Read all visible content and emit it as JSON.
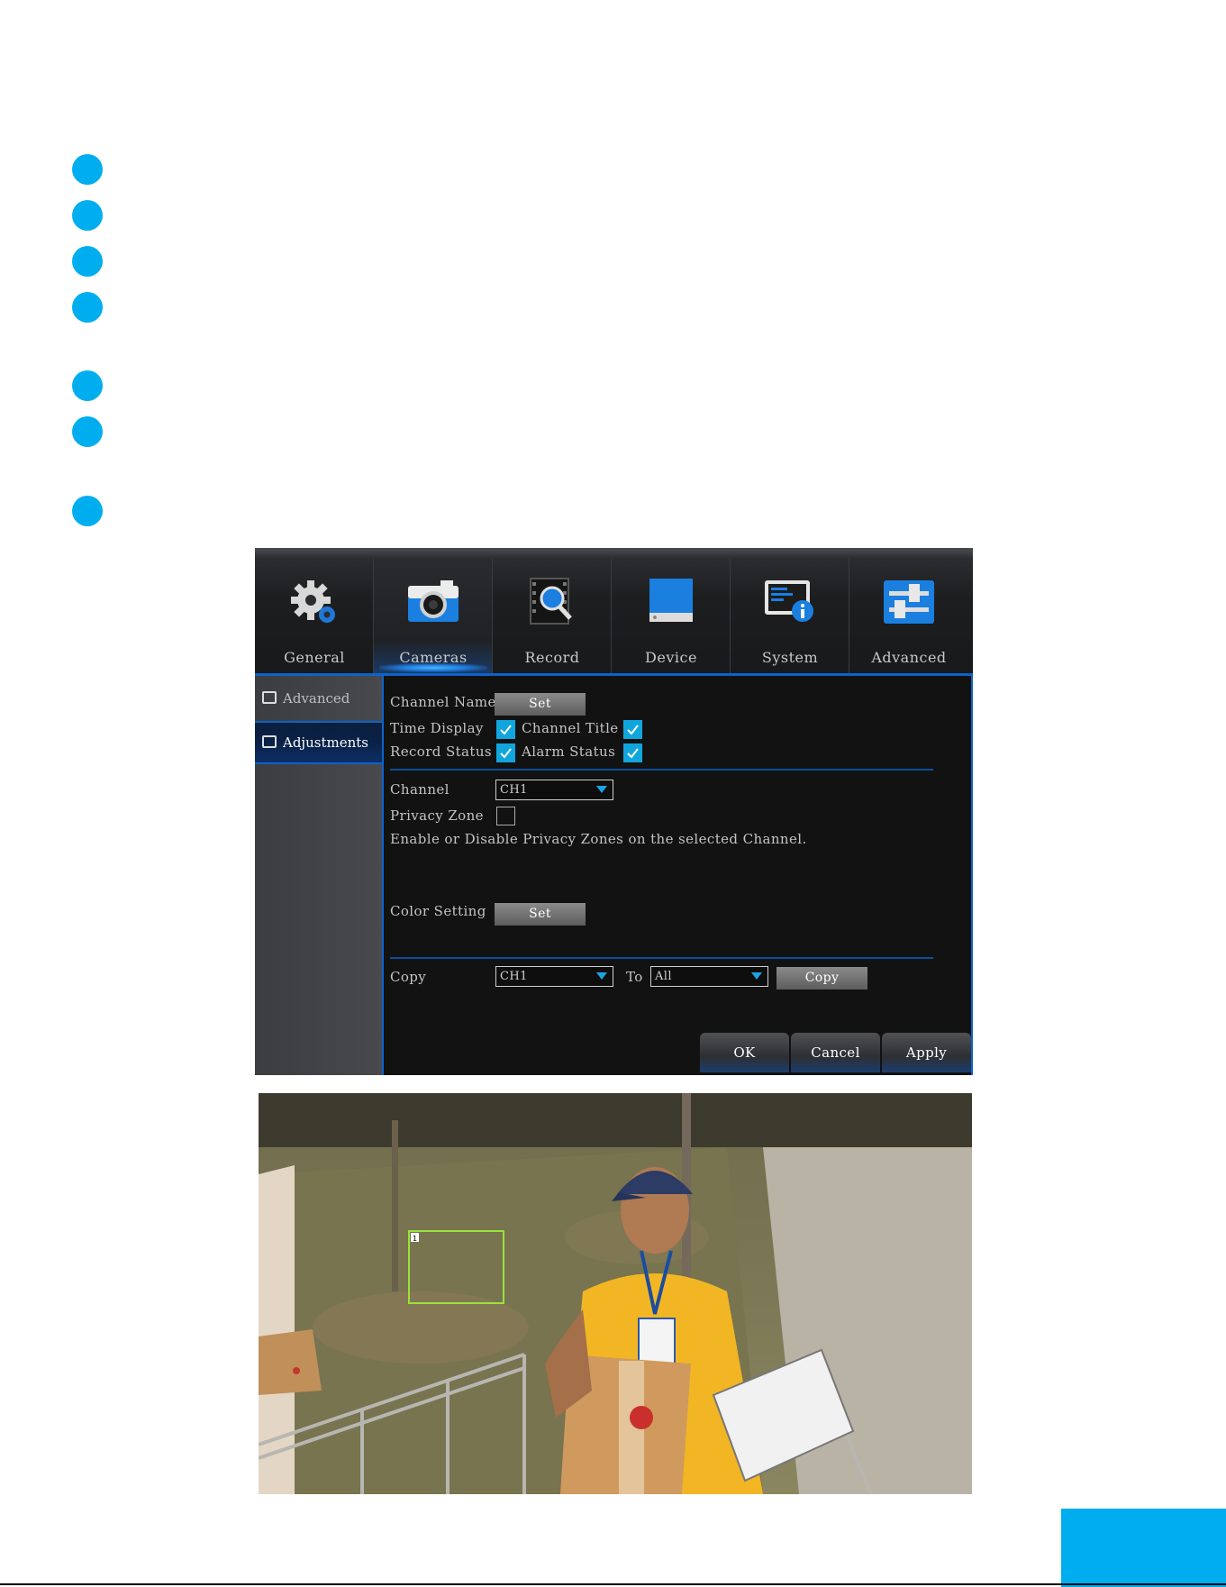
{
  "tabs": [
    {
      "label": "General",
      "icon": "gear-icon"
    },
    {
      "label": "Cameras",
      "icon": "camera-icon"
    },
    {
      "label": "Record",
      "icon": "film-search-icon"
    },
    {
      "label": "Device",
      "icon": "hard-drive-icon"
    },
    {
      "label": "System",
      "icon": "system-info-icon"
    },
    {
      "label": "Advanced",
      "icon": "sliders-icon"
    }
  ],
  "active_tab": "Cameras",
  "sidebar": {
    "items": [
      {
        "label": "Advanced",
        "icon": "monitor-icon"
      },
      {
        "label": "Adjustments",
        "icon": "monitor-icon"
      }
    ],
    "selected": "Adjustments"
  },
  "settings": {
    "channel_names_label": "Channel Names",
    "set_label": "Set",
    "time_display_label": "Time Display",
    "time_display_checked": true,
    "channel_title_label": "Channel Title",
    "channel_title_checked": true,
    "record_status_label": "Record Status",
    "record_status_checked": true,
    "alarm_status_label": "Alarm Status",
    "alarm_status_checked": true,
    "channel_label": "Channel",
    "channel_value": "CH1",
    "privacy_zone_label": "Privacy Zone",
    "privacy_zone_checked": false,
    "privacy_help": "Enable or Disable Privacy Zones on the selected Channel.",
    "color_setting_label": "Color Setting",
    "color_set_label": "Set",
    "copy_label": "Copy",
    "copy_from_value": "CH1",
    "to_label": "To",
    "copy_to_value": "All",
    "copy_button_label": "Copy"
  },
  "footer": {
    "ok": "OK",
    "cancel": "Cancel",
    "apply": "Apply"
  },
  "photo": {
    "zone_number": "1"
  },
  "colors": {
    "accent": "#00aeef",
    "dvr_blue": "#0d63c9",
    "check": "#10a6dd",
    "zone_outline": "#9be13c"
  }
}
